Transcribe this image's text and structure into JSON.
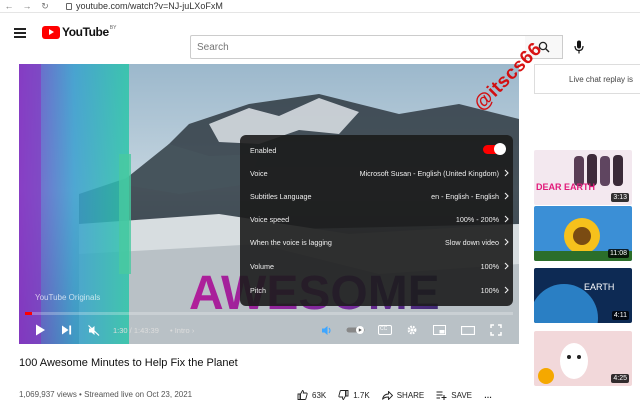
{
  "browser": {
    "url": "youtube.com/watch?v=NJ-juLXoFxM"
  },
  "masthead": {
    "logo_text": "YouTube",
    "logo_region": "BY",
    "search_placeholder": "Search"
  },
  "settings": {
    "rows": [
      {
        "label": "Enabled",
        "value": ""
      },
      {
        "label": "Voice",
        "value": "Microsoft Susan - English (United Kingdom)"
      },
      {
        "label": "Subtitles Language",
        "value": "en - English - English"
      },
      {
        "label": "Voice speed",
        "value": "100% - 200%"
      },
      {
        "label": "When the voice is lagging",
        "value": "Slow down video"
      },
      {
        "label": "Volume",
        "value": "100%"
      },
      {
        "label": "Pitch",
        "value": "100%"
      }
    ],
    "enabled": true
  },
  "player": {
    "overlay_text": "AWESOME",
    "channel_watermark": "YouTube Originals",
    "time": "1:30 / 1:43:39",
    "chapter": "Intro",
    "cc_label": "CC",
    "progress_fraction": 0.015
  },
  "video": {
    "title": "100 Awesome Minutes to Help Fix the Planet",
    "meta": "1,069,937 views • Streamed live on Oct 23, 2021",
    "likes": "63K",
    "dislikes": "1.7K",
    "share": "SHARE",
    "save": "SAVE"
  },
  "sidebar": {
    "live_chat": "Live chat replay is",
    "recs": [
      {
        "duration": "3:13",
        "label": "DEAR EARTH"
      },
      {
        "duration": "11:08"
      },
      {
        "duration": "4:11",
        "label": "EARTH"
      },
      {
        "duration": "4:25"
      }
    ]
  },
  "watermark": "@itscs66",
  "colors": {
    "accent": "#ff0000",
    "panel": "#1c1c1c"
  }
}
